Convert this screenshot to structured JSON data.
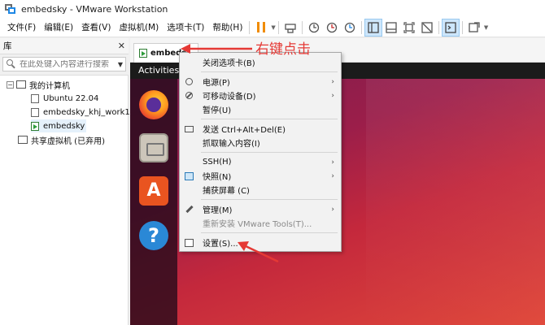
{
  "window": {
    "title": "embedsky - VMware Workstation"
  },
  "menubar": {
    "items": [
      "文件(F)",
      "编辑(E)",
      "查看(V)",
      "虚拟机(M)",
      "选项卡(T)",
      "帮助(H)"
    ]
  },
  "toolbar": {
    "icons": [
      "pause-icon",
      "send-keys-icon",
      "snapshot-icon",
      "revert-snapshot-icon",
      "snapshot-manager-icon",
      "library-view-icon",
      "thumbnail-view-icon",
      "fit-icon",
      "unity-icon",
      "console-icon",
      "fullscreen-icon"
    ]
  },
  "library": {
    "title": "库",
    "search_placeholder": "在此处键入内容进行搜索",
    "tree": {
      "root": "我的计算机",
      "vms": [
        "Ubuntu 22.04",
        "embedsky_khj_work1",
        "embedsky"
      ],
      "shared": "共享虚拟机 (已弃用)"
    }
  },
  "tab": {
    "label": "embeds"
  },
  "guest": {
    "topbar_label": "Activities",
    "dock": [
      "firefox-icon",
      "files-icon",
      "software-store-icon",
      "help-icon"
    ]
  },
  "context_menu": {
    "items": [
      {
        "label": "关闭选项卡(B)",
        "icon": "none",
        "submenu": false,
        "disabled": false
      },
      {
        "label": "电源(P)",
        "icon": "power-icon",
        "submenu": true,
        "disabled": false
      },
      {
        "label": "可移动设备(D)",
        "icon": "removable-device-icon",
        "submenu": true,
        "disabled": false
      },
      {
        "label": "暂停(U)",
        "icon": "none",
        "submenu": false,
        "disabled": false
      },
      {
        "label": "发送 Ctrl+Alt+Del(E)",
        "icon": "keyboard-icon",
        "submenu": false,
        "disabled": false
      },
      {
        "label": "抓取输入内容(I)",
        "icon": "none",
        "submenu": false,
        "disabled": false
      },
      {
        "label": "SSH(H)",
        "icon": "none",
        "submenu": true,
        "disabled": false
      },
      {
        "label": "快照(N)",
        "icon": "snapshot-icon",
        "submenu": true,
        "disabled": false
      },
      {
        "label": "捕获屏幕 (C)",
        "icon": "none",
        "submenu": false,
        "disabled": false
      },
      {
        "label": "管理(M)",
        "icon": "wrench-icon",
        "submenu": true,
        "disabled": false
      },
      {
        "label": "重新安装 VMware Tools(T)...",
        "icon": "none",
        "submenu": false,
        "disabled": true
      },
      {
        "label": "设置(S)...",
        "icon": "settings-icon",
        "submenu": false,
        "disabled": false
      }
    ]
  },
  "annotation": {
    "text": "右键点击",
    "color": "#e53935"
  }
}
